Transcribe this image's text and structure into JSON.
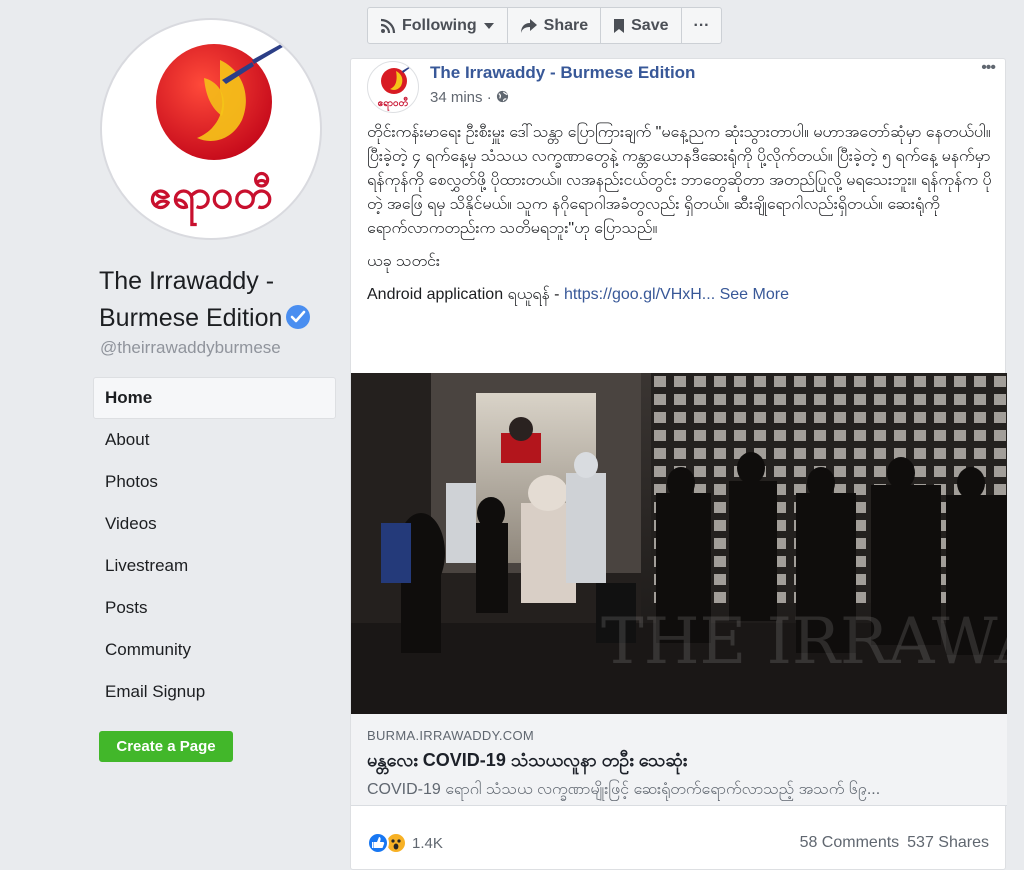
{
  "page": {
    "logo_text": "ဧရာဝတီ",
    "name": "The Irrawaddy - Burmese Edition",
    "handle": "@theirrawaddyburmese",
    "verified_color": "#4a8ef0"
  },
  "nav": {
    "items": [
      "Home",
      "About",
      "Photos",
      "Videos",
      "Livestream",
      "Posts",
      "Community",
      "Email Signup"
    ],
    "active": "Home"
  },
  "create_page_label": "Create a Page",
  "toolbar": {
    "following_label": "Following",
    "share_label": "Share",
    "save_label": "Save",
    "more_label": "···"
  },
  "post": {
    "author": "The Irrawaddy - Burmese Edition",
    "time": "34 mins ·",
    "more": "•••",
    "text": "တိုင်းကန်းမာရေး ဦးစီးမှူး ဒေါ်သန္တာ ပြောကြားချက် \"မနေ့ညက ဆုံးသွားတာပါ။ မဟာအတော်ဆုံမှာ နေတယ်ပါ။ ပြီးခဲ့တဲ့ ၄ ရက်နေ့မှ သံသယ လက္ခဏာတွေနဲ့ ကန္တာယောနဒီဆေးရုံကို ပို့လိုက်တယ်။ ပြီးခဲ့တဲ့ ၅ ရက်နေ့ မနက်မှာ ရန်ကုန်ကို စေလွှတ်ဖို့ ပိုထားတယ်။ လအနည်းငယ်တွင်း ဘာတွေဆိုတာ အတည်ပြုလို့ မရသေးဘူး။ ရန်ကုန်က ပိုတဲ့ အဖြေ ရမှ သိနိုင်မယ်။ သူက နဂိုရောဂါအခံတွလည်း ရှိတယ်။ ဆီးချိုရောဂါလည်းရှိတယ်။ ဆေးရုံကို ရောက်လာကတည်းက သတိမရဘူး\"ဟု ပြောသည်။",
    "credit": "ယခု သတင်း",
    "android_prefix": "Android application ရယူရန် - ",
    "android_link": "https://goo.gl/VHxH...",
    "see_more": "See More",
    "watermark": "THE IRRAWADDY"
  },
  "link_preview": {
    "domain": "BURMA.IRRAWADDY.COM",
    "title": "မန္တလေး COVID-19 သံသယလူနာ တဦး သေဆုံး",
    "description": "COVID-19 ရောဂါ သံသယ လက္ခဏာမျိုးဖြင့် ဆေးရုံတက်ရောက်လာသည့် အသက် ၆၉..."
  },
  "engagement": {
    "reaction_count": "1.4K",
    "comments": "58 Comments",
    "shares": "537 Shares"
  },
  "colors": {
    "link": "#385898",
    "create_button": "#42b72a",
    "like_blue": "#1877f2",
    "wow_yellow": "#f7b125"
  }
}
